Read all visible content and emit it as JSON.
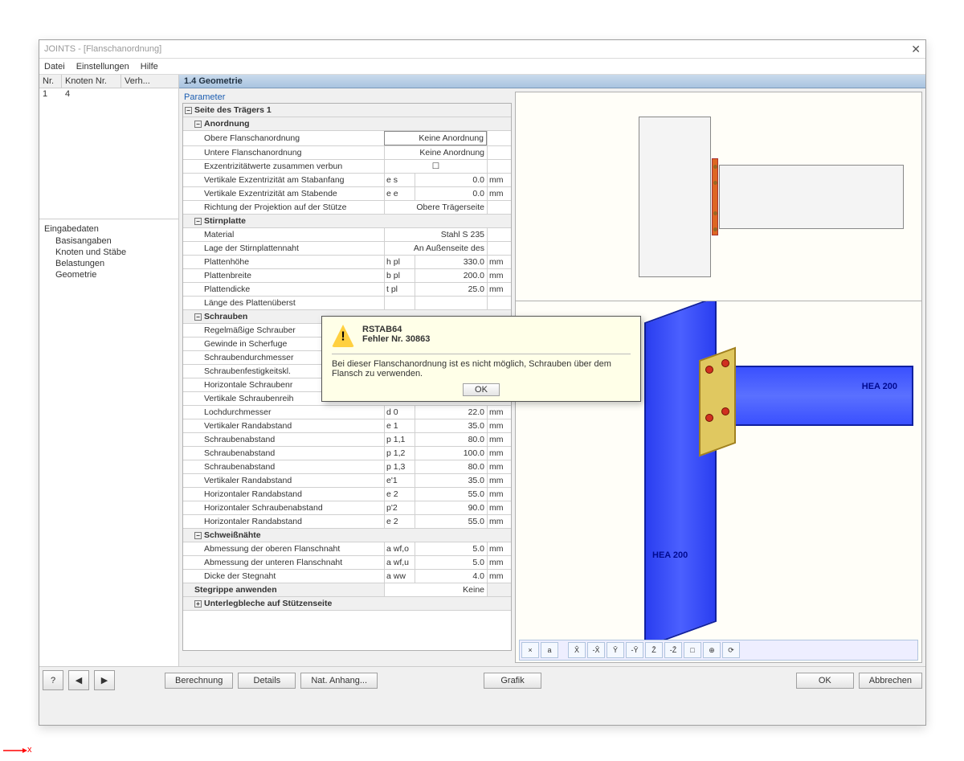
{
  "title": "JOINTS - [Flanschanordnung]",
  "menus": [
    "Datei",
    "Einstellungen",
    "Hilfe"
  ],
  "left_grid": {
    "headers": [
      "Nr.",
      "Knoten Nr.",
      "Verh..."
    ],
    "row": {
      "nr": "1",
      "knoten": "4"
    }
  },
  "tree": {
    "root": "Eingabedaten",
    "items": [
      "Basisangaben",
      "Knoten und Stäbe",
      "Belastungen",
      "Geometrie"
    ]
  },
  "pane_title": "1.4 Geometrie",
  "param_caption": "Parameter",
  "groups": {
    "side": "Seite des Trägers 1",
    "anord": "Anordnung",
    "stirn": "Stirnplatte",
    "schr": "Schrauben",
    "schw": "Schweißnähte",
    "steg": "Stegrippe anwenden",
    "unter": "Unterlegbleche auf Stützenseite"
  },
  "rows": {
    "obere": {
      "l": "Obere Flanschanordnung",
      "v": "Keine Anordnung"
    },
    "untere": {
      "l": "Untere Flanschanordnung",
      "v": "Keine Anordnung"
    },
    "exz": {
      "l": "Exzentrizitätwerte zusammen verbun"
    },
    "vexs": {
      "l": "Vertikale Exzentrizität am Stabanfang",
      "s": "e s",
      "v": "0.0",
      "u": "mm"
    },
    "vexe": {
      "l": "Vertikale Exzentrizität am Stabende",
      "s": "e e",
      "v": "0.0",
      "u": "mm"
    },
    "proj": {
      "l": "Richtung der Projektion auf der Stütze",
      "v": "Obere Trägerseite"
    },
    "mat": {
      "l": "Material",
      "v": "Stahl S 235"
    },
    "lage": {
      "l": "Lage der Stirnplattennaht",
      "v": "An Außenseite des"
    },
    "hpl": {
      "l": "Plattenhöhe",
      "s": "h pl",
      "v": "330.0",
      "u": "mm"
    },
    "bpl": {
      "l": "Plattenbreite",
      "s": "b pl",
      "v": "200.0",
      "u": "mm"
    },
    "tpl": {
      "l": "Plattendicke",
      "s": "t pl",
      "v": "25.0",
      "u": "mm"
    },
    "lpu": {
      "l": "Länge des Plattenüberst"
    },
    "regel": {
      "l": "Regelmäßige Schrauber"
    },
    "gew": {
      "l": "Gewinde in Scherfuge"
    },
    "sdm": {
      "l": "Schraubendurchmesser"
    },
    "sfk": {
      "l": "Schraubenfestigkeitskl."
    },
    "hsr": {
      "l": "Horizontale Schraubenr"
    },
    "vsr": {
      "l": "Vertikale Schraubenreih"
    },
    "d0": {
      "l": "Lochdurchmesser",
      "s": "d 0",
      "v": "22.0",
      "u": "mm"
    },
    "e1": {
      "l": "Vertikaler Randabstand",
      "s": "e 1",
      "v": "35.0",
      "u": "mm"
    },
    "p11": {
      "l": "Schraubenabstand",
      "s": "p 1,1",
      "v": "80.0",
      "u": "mm"
    },
    "p12": {
      "l": "Schraubenabstand",
      "s": "p 1,2",
      "v": "100.0",
      "u": "mm"
    },
    "p13": {
      "l": "Schraubenabstand",
      "s": "p 1,3",
      "v": "80.0",
      "u": "mm"
    },
    "e1p": {
      "l": "Vertikaler Randabstand",
      "s": "e'1",
      "v": "35.0",
      "u": "mm"
    },
    "e2": {
      "l": "Horizontaler Randabstand",
      "s": "e 2",
      "v": "55.0",
      "u": "mm"
    },
    "p2": {
      "l": "Horizontaler Schraubenabstand",
      "s": "p'2",
      "v": "90.0",
      "u": "mm"
    },
    "e2b": {
      "l": "Horizontaler Randabstand",
      "s": "e 2",
      "v": "55.0",
      "u": "mm"
    },
    "awfo": {
      "l": "Abmessung der oberen Flanschnaht",
      "s": "a wf,o",
      "v": "5.0",
      "u": "mm"
    },
    "awfu": {
      "l": "Abmessung der unteren Flanschnaht",
      "s": "a wf,u",
      "v": "5.0",
      "u": "mm"
    },
    "aww": {
      "l": "Dicke der Stegnaht",
      "s": "a ww",
      "v": "4.0",
      "u": "mm"
    },
    "stegv": {
      "v": "Keine"
    }
  },
  "modal": {
    "app": "RSTAB64",
    "errno": "Fehler Nr. 30863",
    "msg": "Bei dieser Flanschanordnung ist es nicht möglich, Schrauben über dem Flansch zu verwenden.",
    "ok": "OK"
  },
  "gfx": {
    "hea": "HEA 200",
    "toolbar": [
      "×",
      "a",
      "X̂",
      "-X̂",
      "Ŷ",
      "-Ŷ",
      "Ẑ",
      "-Ẑ",
      "□",
      "⊕",
      "⟳"
    ]
  },
  "footer": {
    "calc": "Berechnung",
    "details": "Details",
    "anhang": "Nat. Anhang...",
    "grafik": "Grafik",
    "ok": "OK",
    "abbr": "Abbrechen"
  },
  "axis_label": "x"
}
